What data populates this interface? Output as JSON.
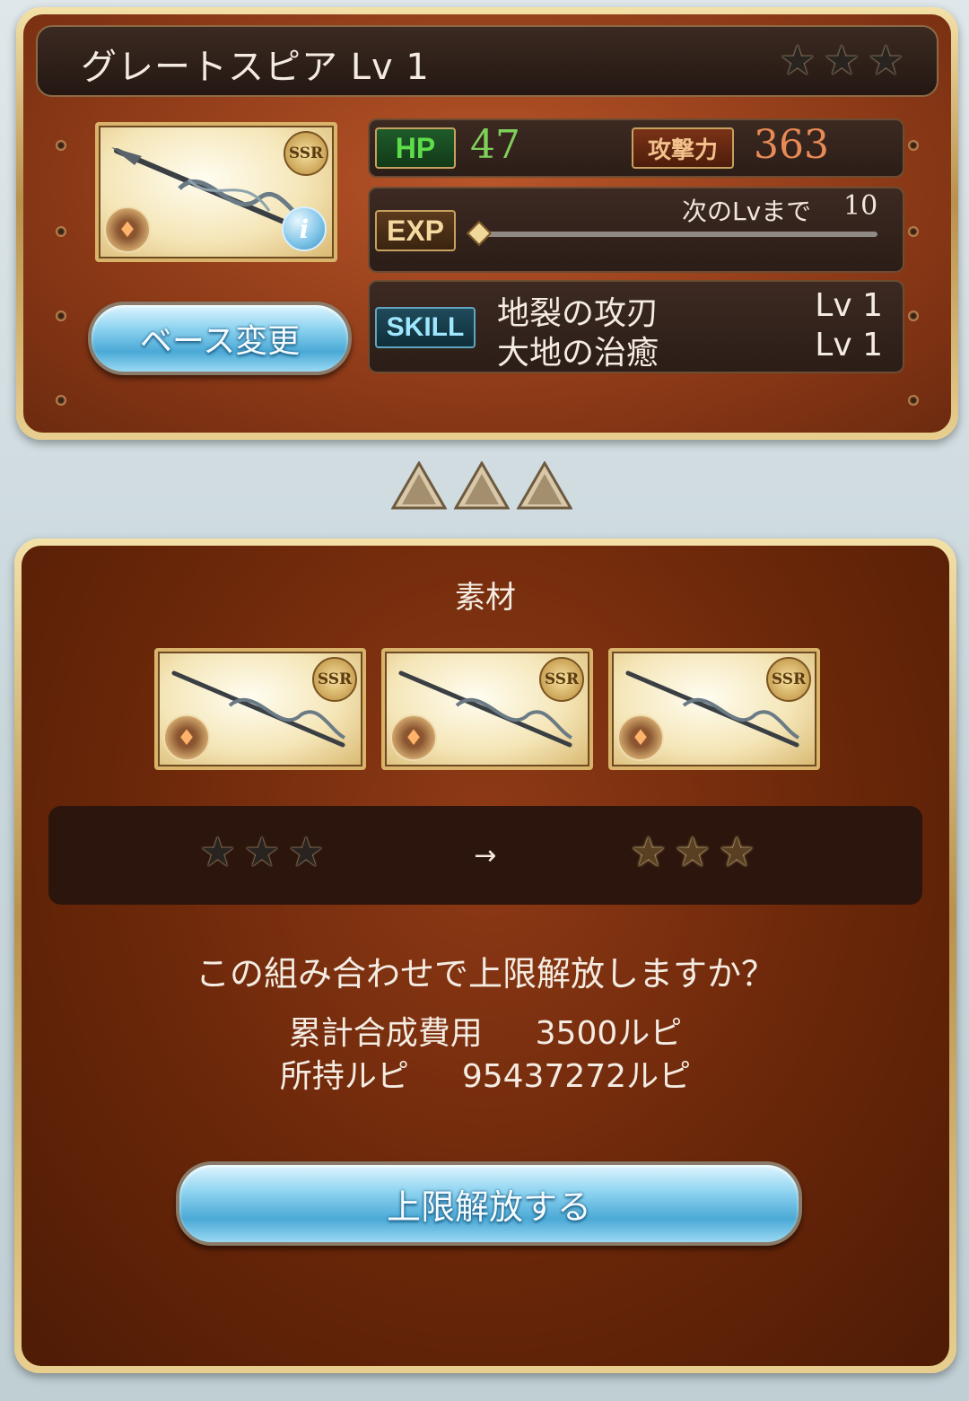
{
  "base_card": {
    "name": "グレートスピア Lv 1",
    "rarity_badge": "SSR",
    "hp_label": "HP",
    "hp_value": "47",
    "atk_label": "攻撃力",
    "atk_value": "363",
    "exp_label": "EXP",
    "next_level_label": "次のLvまで",
    "next_level_value": "10",
    "exp_progress": 0.0,
    "skill_label": "SKILL",
    "skills": [
      {
        "name": "地裂の攻刃",
        "level": "Lv 1"
      },
      {
        "name": "大地の治癒",
        "level": "Lv 1"
      }
    ],
    "change_base_button": "ベース変更",
    "star_count_lit": 0,
    "star_count_total": 3
  },
  "materials": {
    "title": "素材",
    "items": [
      {
        "rarity_badge": "SSR"
      },
      {
        "rarity_badge": "SSR"
      },
      {
        "rarity_badge": "SSR"
      }
    ]
  },
  "uncap_preview": {
    "arrow": "→",
    "before_lit": 0,
    "after_lit": 3,
    "total": 3
  },
  "confirm": {
    "question": "この組み合わせで上限解放しますか？",
    "cost_label": "累計合成費用",
    "cost_value": "3500ルピ",
    "owned_label": "所持ルピ",
    "owned_value": "95437272ルピ",
    "uncap_button": "上限解放する"
  },
  "colors": {
    "hp_text": "#7fcf5a",
    "atk_text": "#e98a55",
    "panel_brown": "#8d3a17",
    "gold": "#d9b36a"
  }
}
